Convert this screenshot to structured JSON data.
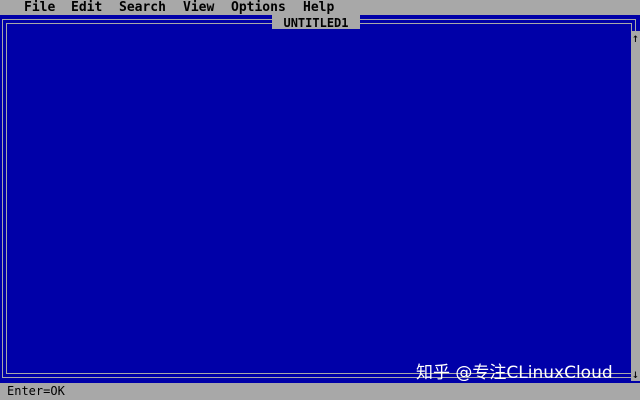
{
  "menu": {
    "items": [
      {
        "label": "File"
      },
      {
        "label": "Edit"
      },
      {
        "label": "Search"
      },
      {
        "label": "View"
      },
      {
        "label": "Options"
      },
      {
        "label": "Help"
      }
    ]
  },
  "window": {
    "title": "UNTITLED1"
  },
  "scrollbar": {
    "up_glyph": "↑",
    "down_glyph": "↓"
  },
  "watermark": {
    "text": "知乎 @专注CLinuxCloud"
  },
  "status": {
    "text": "Enter=OK"
  },
  "colors": {
    "background": "#0000a8",
    "chrome": "#a8a8a8",
    "text_dark": "#000000",
    "text_light": "#ffffff"
  }
}
